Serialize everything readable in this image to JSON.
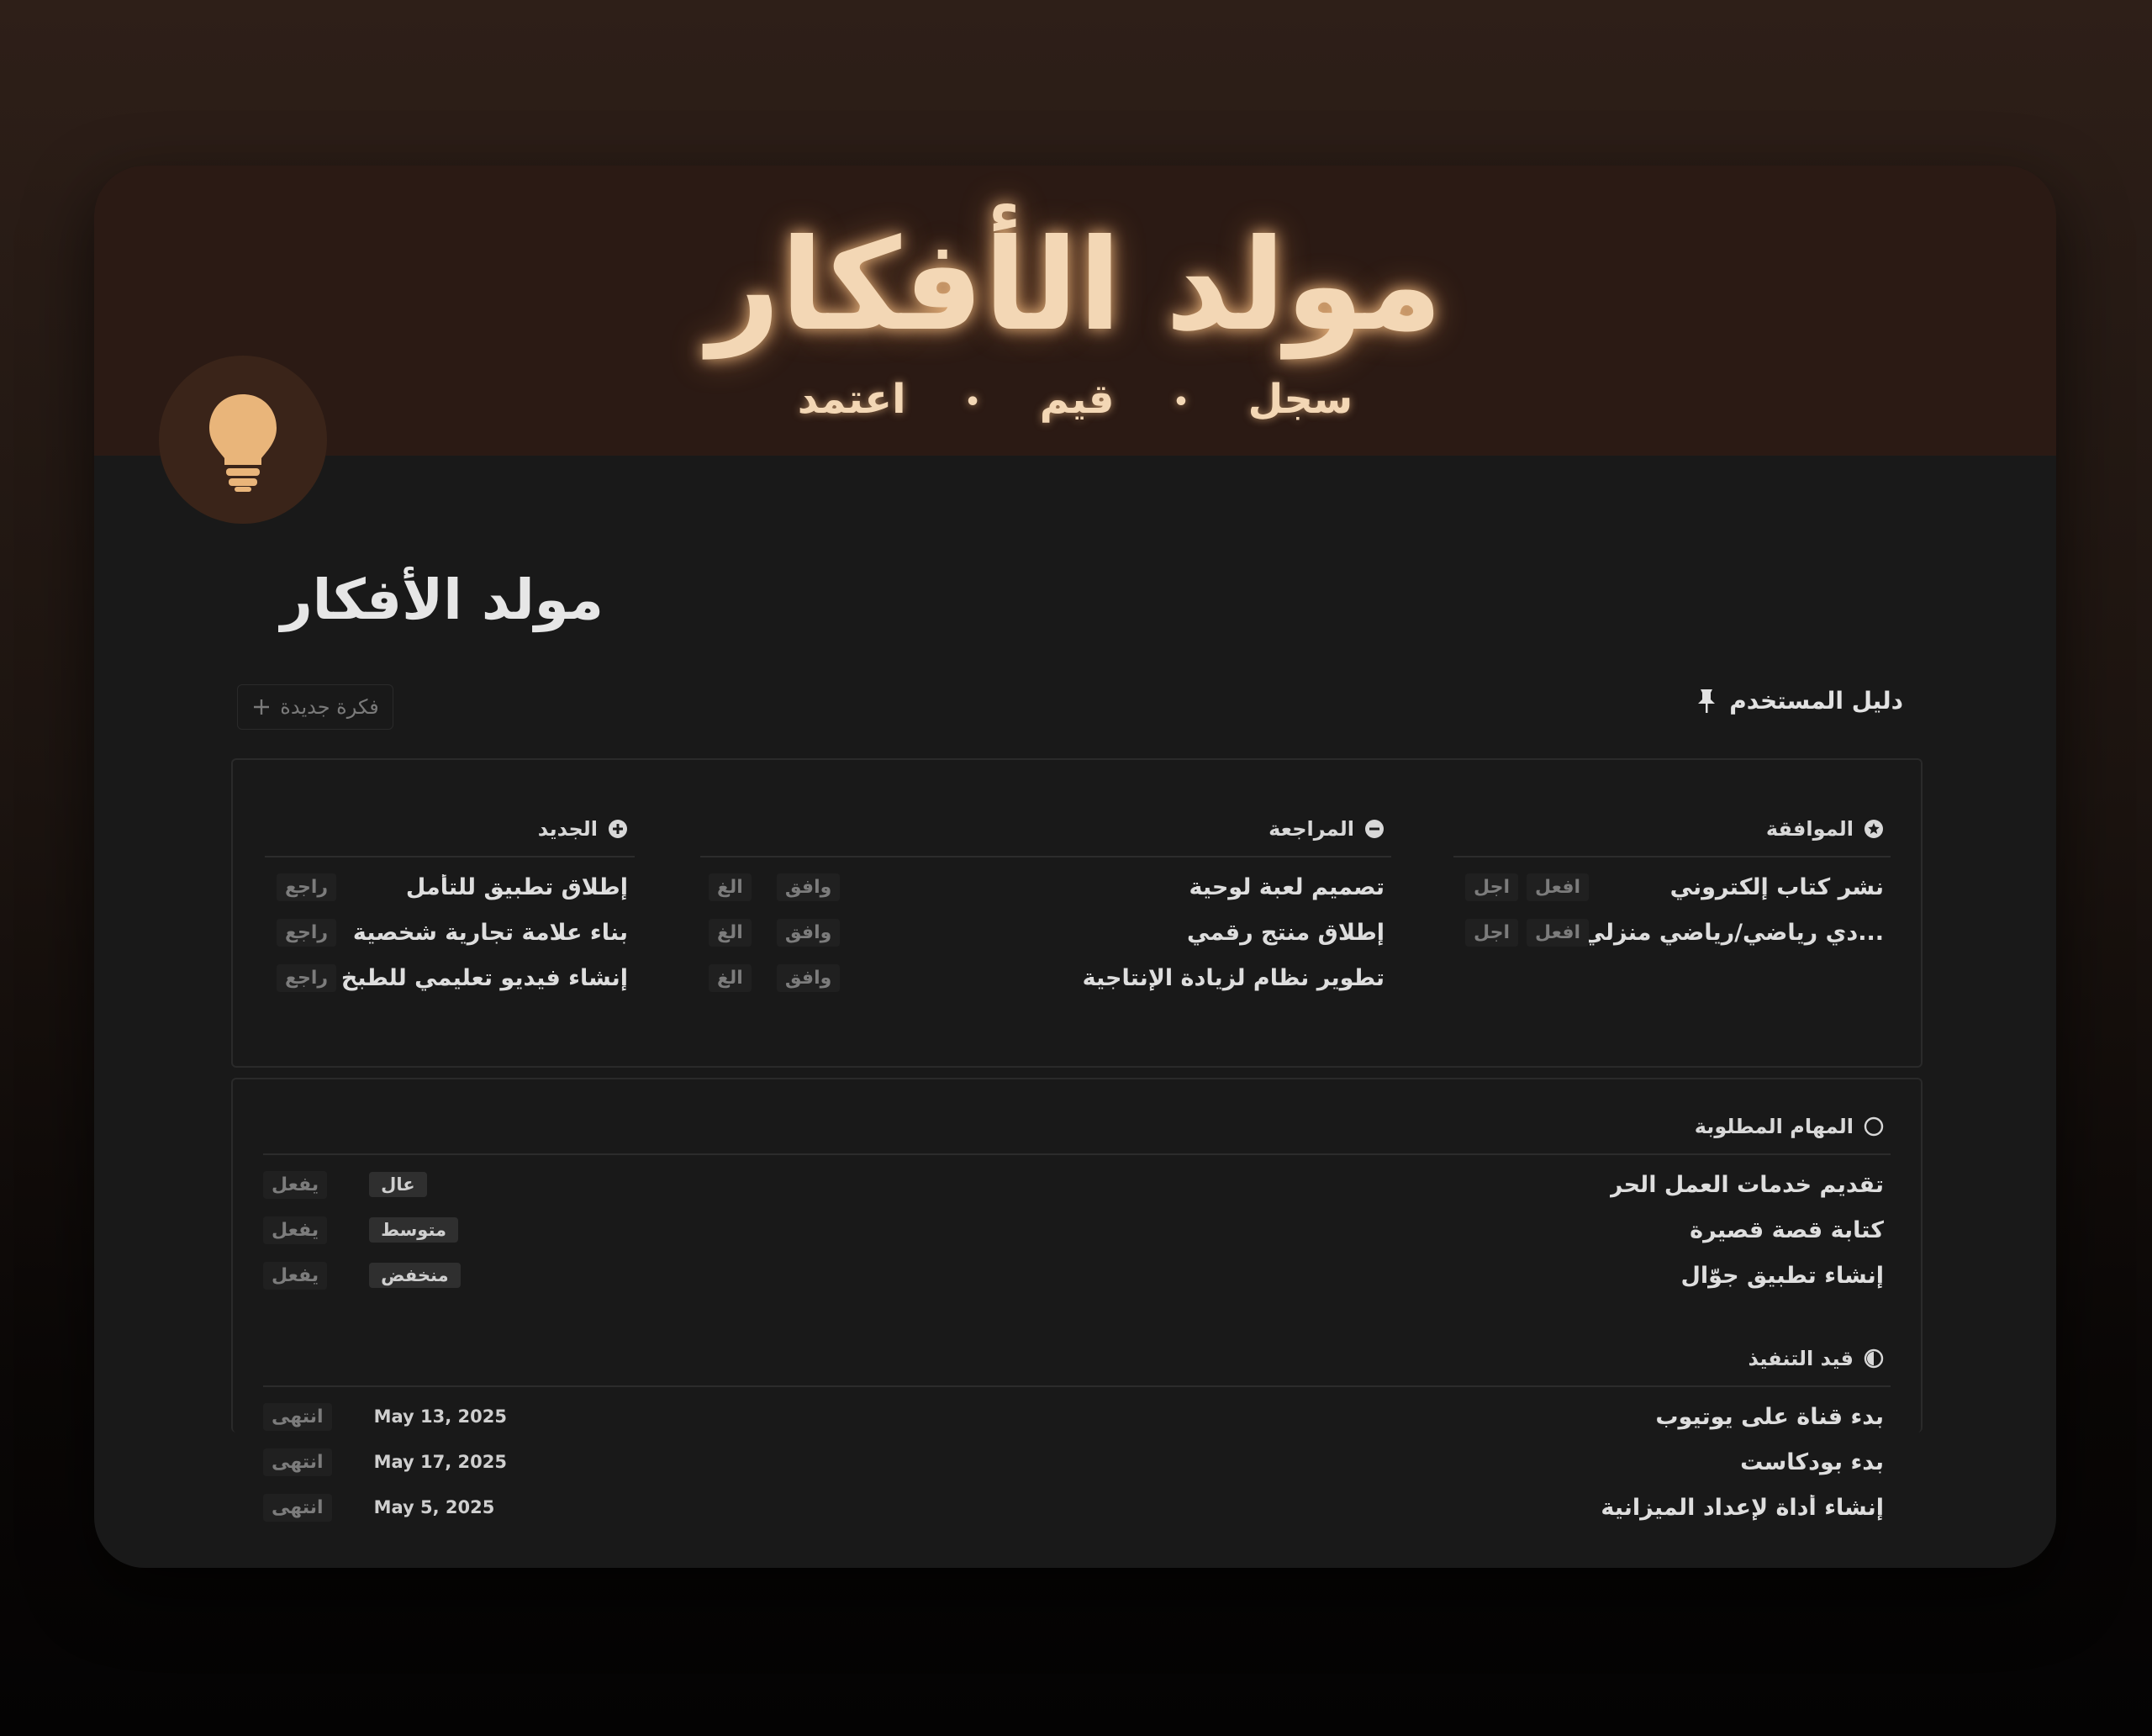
{
  "cover": {
    "title": "مولد الأفكار",
    "subtitle": [
      "سجل",
      "قيم",
      "اعتمد"
    ],
    "dot": "•"
  },
  "page": {
    "title": "مولد الأفكار",
    "icon": "lightbulb-icon"
  },
  "guide": {
    "label": "دليل المستخدم",
    "icon": "pin-icon"
  },
  "new_idea": {
    "label": "فكرة جديدة",
    "icon": "plus-icon"
  },
  "approved": {
    "heading": "الموافقة",
    "icon": "star-circle-icon",
    "rows": [
      {
        "title": "نشر كتاب إلكتروني",
        "actions": [
          "اجل",
          "افعل"
        ]
      },
      {
        "title": "...دي رياضي/رياضي منزلي",
        "actions": [
          "اجل",
          "افعل"
        ]
      }
    ]
  },
  "review": {
    "heading": "المراجعة",
    "icon": "minus-circle-icon",
    "rows": [
      {
        "title": "تصميم لعبة لوحية",
        "actions": [
          "الغ",
          "وافق"
        ]
      },
      {
        "title": "إطلاق منتج رقمي",
        "actions": [
          "الغ",
          "وافق"
        ]
      },
      {
        "title": "تطوير نظام لزيادة الإنتاجية",
        "actions": [
          "الغ",
          "وافق"
        ]
      }
    ]
  },
  "new": {
    "heading": "الجديد",
    "icon": "plus-circle-icon",
    "rows": [
      {
        "title": "إطلاق تطبيق للتأمل",
        "action": "راجع"
      },
      {
        "title": "بناء علامة تجارية شخصية",
        "action": "راجع"
      },
      {
        "title": "إنشاء فيديو تعليمي للطبخ",
        "action": "راجع"
      }
    ]
  },
  "todo": {
    "heading": "المهام المطلوبة",
    "icon": "empty-circle-icon",
    "rows": [
      {
        "title": "تقديم خدمات العمل الحر",
        "action": "يفعل",
        "priority": "عال"
      },
      {
        "title": "كتابة قصة قصيرة",
        "action": "يفعل",
        "priority": "متوسط"
      },
      {
        "title": "إنشاء تطبيق جوّال",
        "action": "يفعل",
        "priority": "منخفض"
      }
    ]
  },
  "inprogress": {
    "heading": "قيد التنفيذ",
    "icon": "half-circle-icon",
    "rows": [
      {
        "title": "بدء قناة على يوتيوب",
        "action": "انتهى",
        "date": "May 13, 2025"
      },
      {
        "title": "بدء بودكاست",
        "action": "انتهى",
        "date": "May 17, 2025"
      },
      {
        "title": "إنشاء أداة لإعداد الميزانية",
        "action": "انتهى",
        "date": "May 5, 2025"
      }
    ]
  }
}
